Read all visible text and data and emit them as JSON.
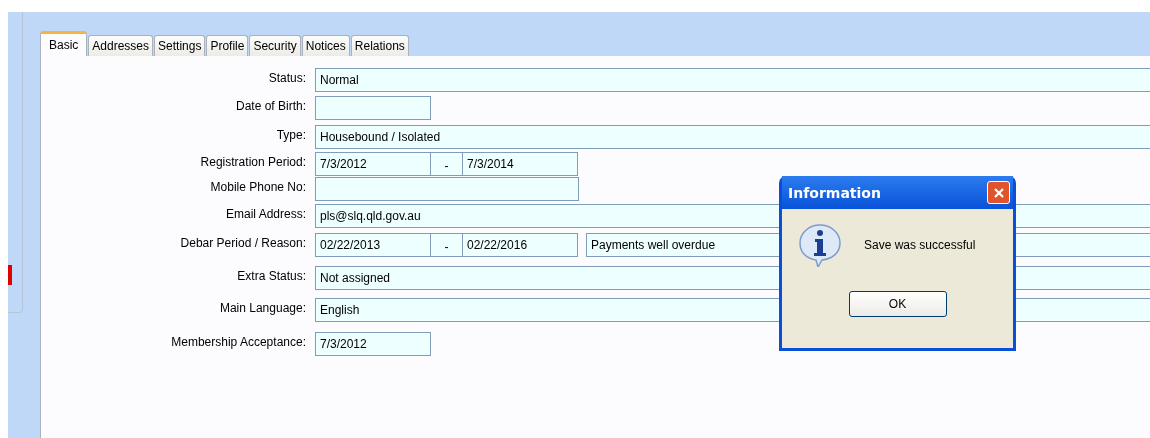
{
  "tabs": [
    {
      "label": "Basic",
      "selected": true
    },
    {
      "label": "Addresses",
      "selected": false
    },
    {
      "label": "Settings",
      "selected": false
    },
    {
      "label": "Profile",
      "selected": false
    },
    {
      "label": "Security",
      "selected": false
    },
    {
      "label": "Notices",
      "selected": false
    },
    {
      "label": "Relations",
      "selected": false
    }
  ],
  "fields": [
    {
      "label": "Status:",
      "kind": "wide",
      "value": "Normal"
    },
    {
      "label": "Date of Birth:",
      "kind": "short"
    },
    {
      "label": "Type:",
      "kind": "wide",
      "value": "Housebound / Isolated"
    },
    {
      "label": "Registration Period:",
      "kind": "range",
      "from": "7/3/2012",
      "separator": "-",
      "to": "7/3/2014"
    },
    {
      "label": "Mobile Phone No:",
      "kind": "medium"
    },
    {
      "label": "Email Address:",
      "kind": "wide",
      "value": "pls@slq.qld.gov.au"
    },
    {
      "label": "Debar Period / Reason:",
      "kind": "range",
      "from": "02/22/2013",
      "separator": "-",
      "to": "02/22/2016",
      "reason": "Payments well overdue"
    },
    {
      "label": "Extra Status:",
      "kind": "wide",
      "value": "Not assigned"
    },
    {
      "label": "Main Language:",
      "kind": "wide",
      "value": "English"
    },
    {
      "label": "Membership Acceptance:",
      "kind": "short",
      "value": "7/3/2012"
    }
  ],
  "dialog": {
    "title": "Information",
    "message": "Save was successful",
    "button": "OK"
  }
}
